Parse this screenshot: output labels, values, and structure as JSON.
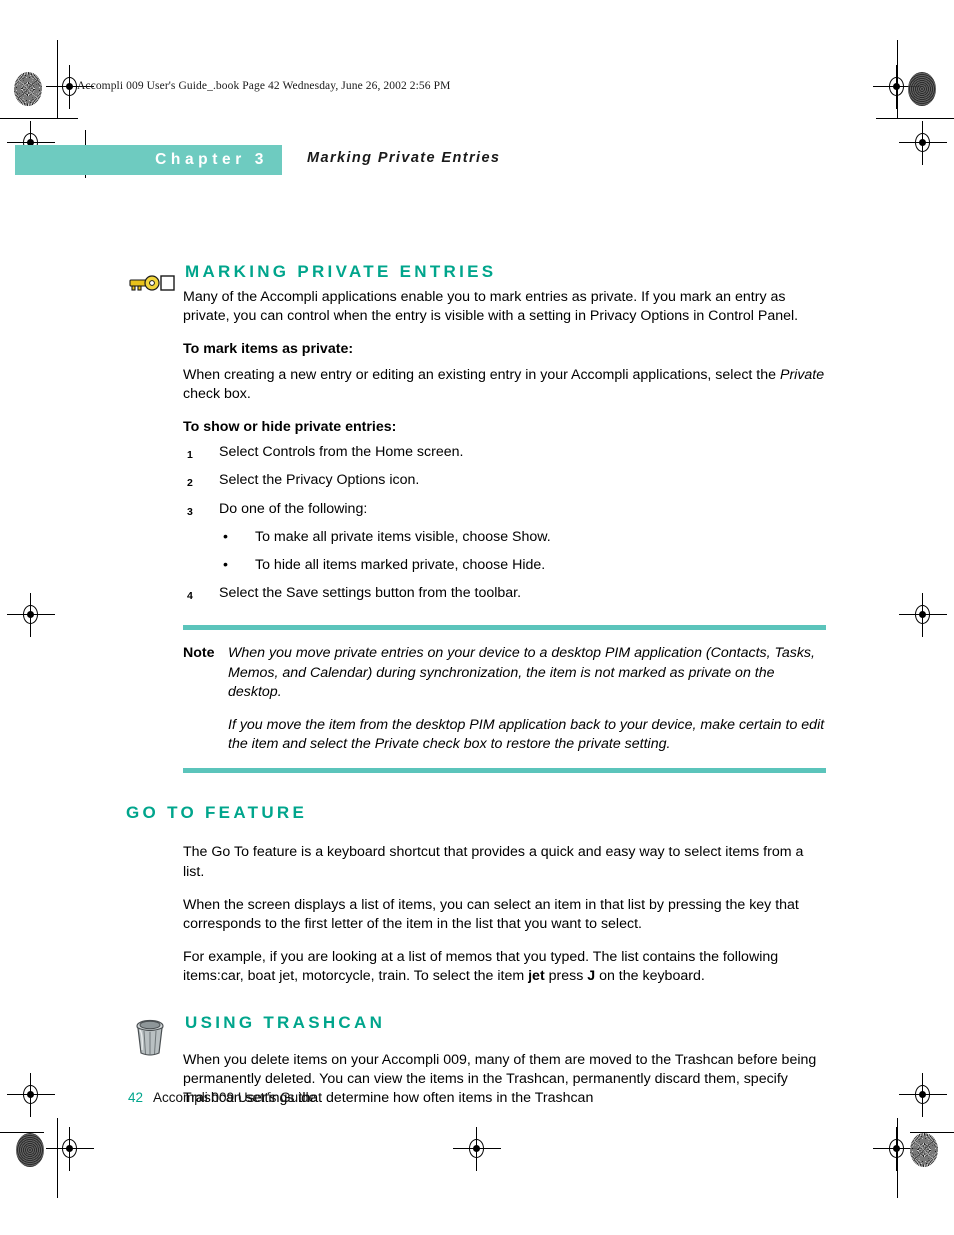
{
  "file_header": "Accompli 009 User's Guide_.book  Page 42  Wednesday, June 26, 2002  2:56 PM",
  "chapter": {
    "label": "Chapter 3",
    "subject": "Marking Private Entries",
    "band_color": "#6ecbc0"
  },
  "theme": {
    "heading_color": "#00a58c",
    "rule_color": "#5bc4bb",
    "band_color": "#6ecbc0"
  },
  "sections": {
    "marking_private_entries": {
      "icon": "key-icon",
      "heading": "MARKING PRIVATE ENTRIES",
      "intro": "Many of the Accompli applications enable you to mark entries as private. If you mark an entry as private, you can control when the entry is visible with a setting in Privacy Options in Control Panel.",
      "subhead_mark": "To mark items as private:",
      "mark_para_part1": "When creating a new entry or editing an existing entry in your Accompli applications, select the ",
      "mark_para_italic": "Private",
      "mark_para_part2": " check box.",
      "subhead_showhide": "To show or hide private entries:",
      "steps": [
        {
          "num": "1",
          "text": "Select Controls from the Home screen."
        },
        {
          "num": "2",
          "text": "Select the Privacy Options icon."
        },
        {
          "num": "3",
          "text": "Do one of the following:"
        },
        {
          "num": "4",
          "text": "Select the Save settings button from the toolbar."
        }
      ],
      "bullets": [
        {
          "marker": "•",
          "text": "To make all private items visible, choose Show."
        },
        {
          "marker": "•",
          "text": "To hide all items marked private, choose Hide."
        }
      ],
      "note": {
        "tag": "Note",
        "para1": "When you move private entries on your device to a desktop PIM application (Contacts, Tasks, Memos, and Calendar) during synchronization, the item is not marked as private on the desktop.",
        "para2": "If you move the item from the desktop PIM application back to your device, make certain to edit the item and select the Private check box to restore the private setting."
      }
    },
    "go_to_feature": {
      "heading": "GO TO FEATURE",
      "para1": "The Go To feature is a keyboard shortcut that provides a quick and easy way to select items from a list.",
      "para2": "When the screen displays a list of items, you can select an item in that list by pressing the key that corresponds to the first letter of the item in the list that you want to select.",
      "para3_part1": "For example, if you are looking at a list of memos that you typed. The list contains the following items:car, boat jet, motorcycle, train. To select the item ",
      "para3_bold1": "jet",
      "para3_part2": " press ",
      "para3_bold2": "J",
      "para3_part3": " on the keyboard."
    },
    "using_trashcan": {
      "icon": "trashcan-icon",
      "heading": "USING TRASHCAN",
      "para1": "When you delete items on your Accompli 009, many of them are moved to the Trashcan before being permanently deleted. You can view the items in the Trashcan, permanently discard them, specify Trashcan settings that determine how often items in the Trashcan"
    }
  },
  "footer": {
    "page_number": "42",
    "guide_title": "Accompli 009 User’s Guide"
  }
}
